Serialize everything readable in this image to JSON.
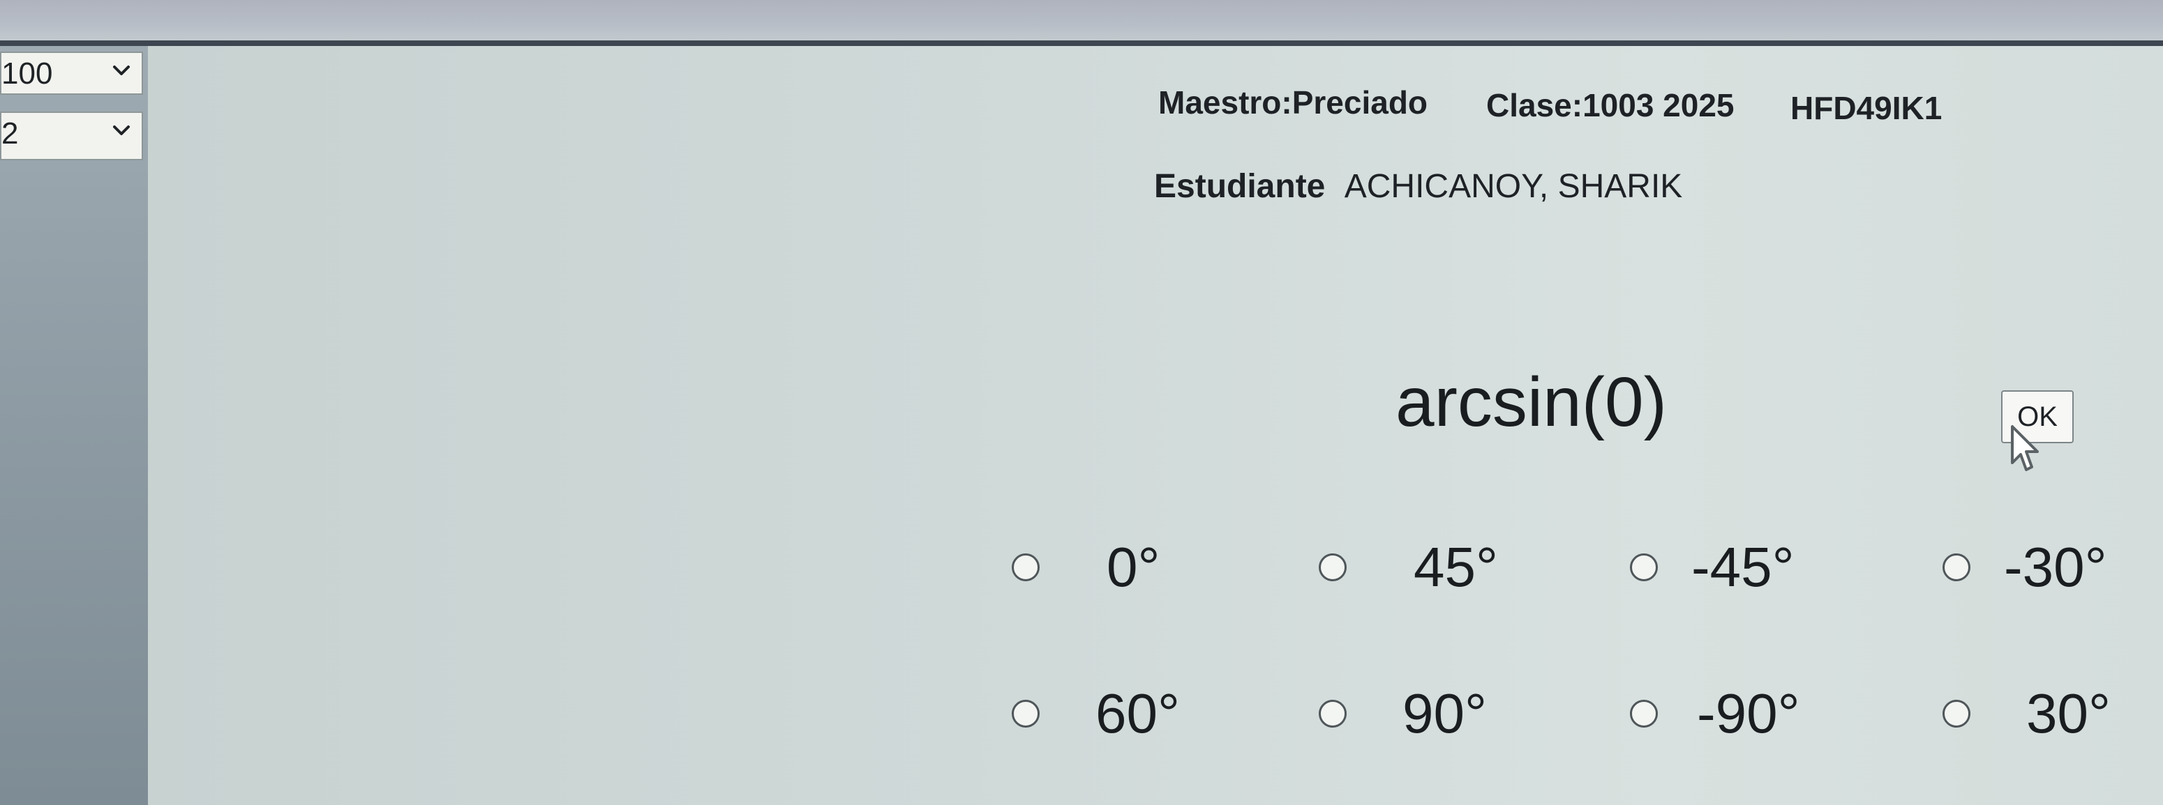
{
  "selectors": [
    {
      "value": "100"
    },
    {
      "value": "2"
    }
  ],
  "header": {
    "teacher": "Maestro:Preciado",
    "class": "Clase:1003 2025",
    "code": "HFD49IK1"
  },
  "student": {
    "label": "Estudiante",
    "name": "ACHICANOY, SHARIK"
  },
  "question": {
    "text": "arcsin(0)"
  },
  "ok_button": {
    "label": "OK"
  },
  "options": [
    {
      "label": "0°"
    },
    {
      "label": "45°"
    },
    {
      "label": "-45°"
    },
    {
      "label": "-30°"
    },
    {
      "label": "60°"
    },
    {
      "label": "90°"
    },
    {
      "label": "-90°"
    },
    {
      "label": "30°"
    }
  ]
}
